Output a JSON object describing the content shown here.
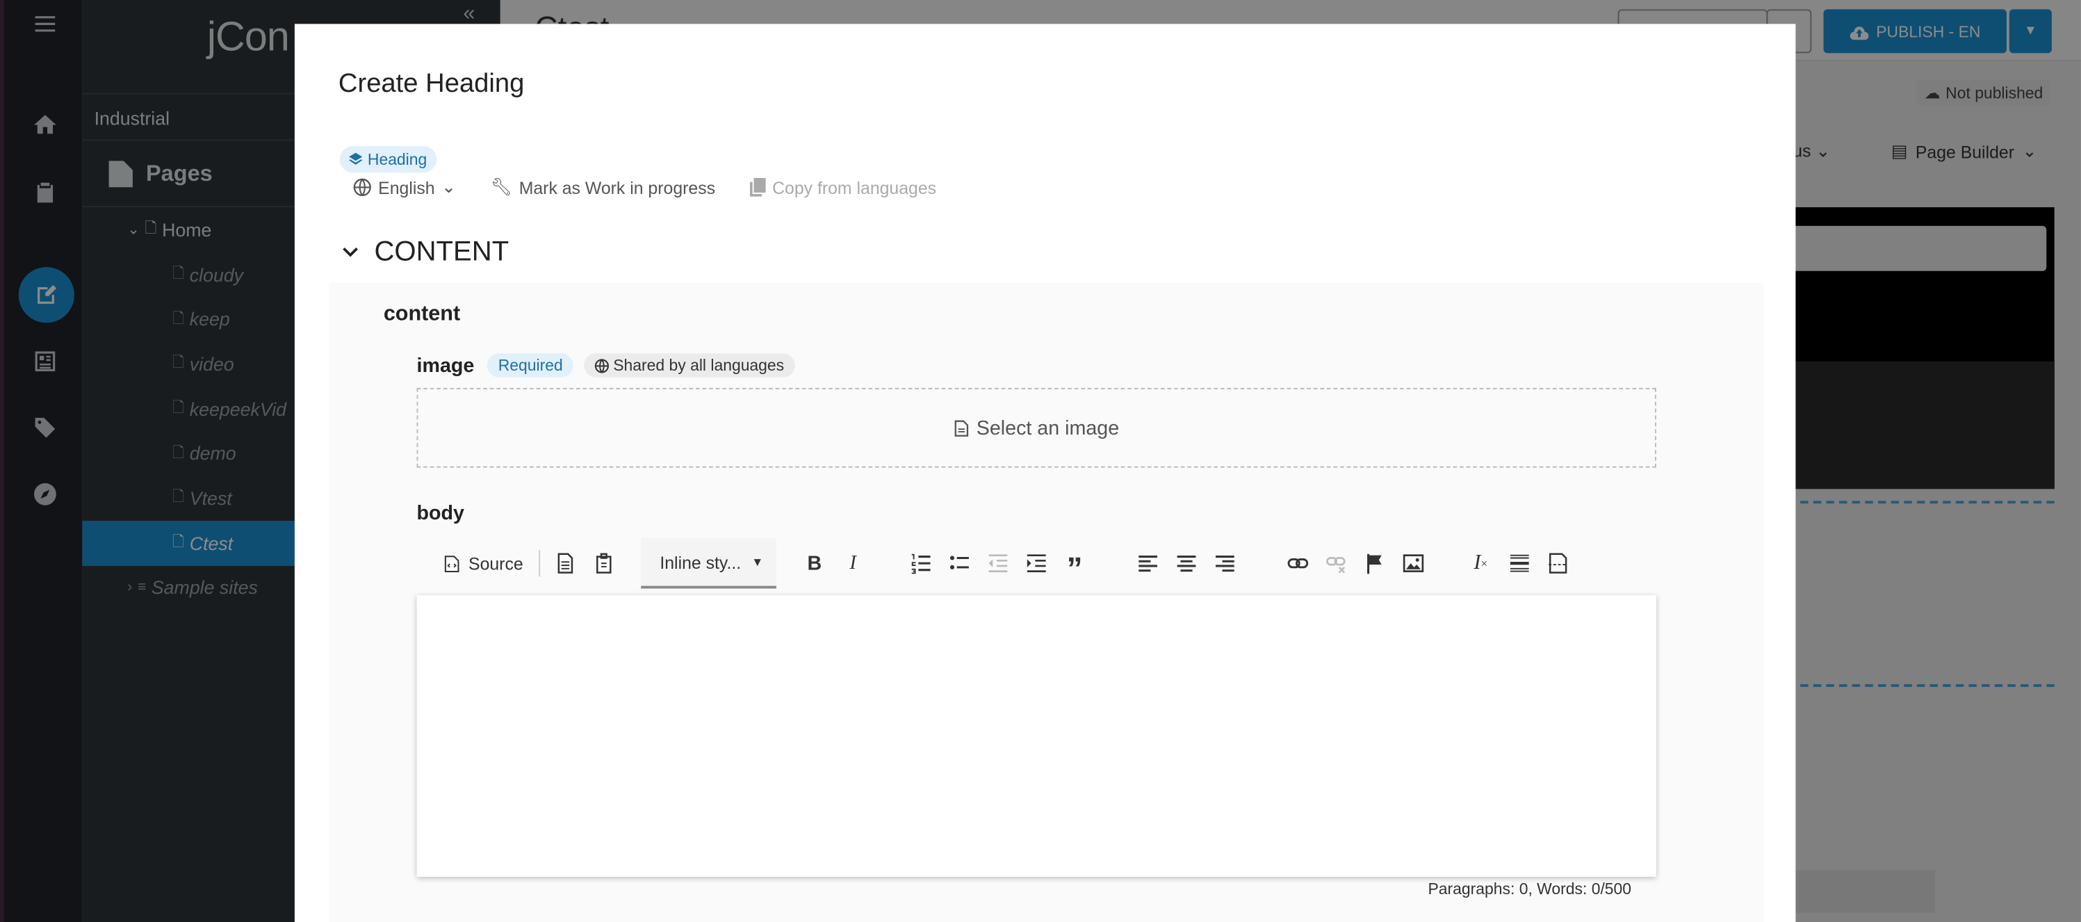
{
  "app": {
    "brand": "jCon"
  },
  "sidebar": {
    "site": "Industrial",
    "pages_label": "Pages",
    "tree": [
      {
        "label": "Home",
        "kind": "home"
      },
      {
        "label": "cloudy",
        "kind": "child"
      },
      {
        "label": "keep",
        "kind": "child"
      },
      {
        "label": "video",
        "kind": "child"
      },
      {
        "label": "keepeekVid",
        "kind": "child"
      },
      {
        "label": "demo",
        "kind": "child"
      },
      {
        "label": "Vtest",
        "kind": "child"
      },
      {
        "label": "Ctest",
        "kind": "child-selected"
      },
      {
        "label": "Sample sites",
        "kind": "group"
      }
    ]
  },
  "page": {
    "title": "Ctest",
    "publish_label": "PUBLISH - EN",
    "not_published": "Not published",
    "status_label": "atus",
    "page_builder": "Page Builder"
  },
  "dialog": {
    "title": "Create Heading",
    "type_chip": "Heading",
    "language": "English",
    "wip": "Mark as Work in progress",
    "copy": "Copy from languages",
    "section": "CONTENT",
    "group_label": "content",
    "image_label": "image",
    "required": "Required",
    "shared": "Shared by all languages",
    "select_image": "Select an image",
    "body_label": "body",
    "toolbar": {
      "source": "Source",
      "inline_style": "Inline sty..."
    },
    "counter": "Paragraphs: 0, Words: 0/500"
  },
  "colors": {
    "accent": "#1b8ed0",
    "rail": "#1f2428",
    "sidebar": "#2f3439"
  }
}
